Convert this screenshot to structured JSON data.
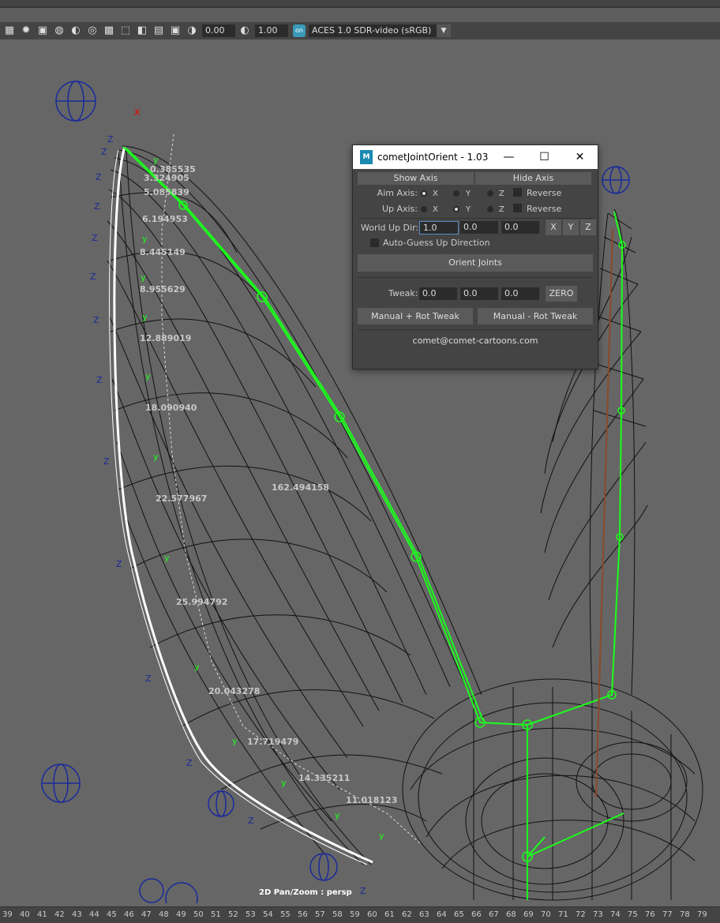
{
  "toolbar": {
    "exposure": "0.00",
    "gamma": "1.00",
    "color_mgmt_badge": "on",
    "view_transform": "ACES 1.0 SDR-video (sRGB)"
  },
  "viewport": {
    "label": "2D Pan/Zoom : persp",
    "measurements": [
      "0.385535",
      "3.324905",
      "5.085839",
      "6.194953",
      "8.445149",
      "8.955629",
      "12.889019",
      "18.090940",
      "22.577967",
      "162.494158",
      "25.994792",
      "20.043278",
      "17.719479",
      "14.335211",
      "11.018123"
    ]
  },
  "ruler": {
    "ticks": [
      "39",
      "40",
      "41",
      "42",
      "43",
      "44",
      "45",
      "46",
      "47",
      "48",
      "49",
      "50",
      "51",
      "52",
      "53",
      "54",
      "55",
      "56",
      "57",
      "58",
      "59",
      "60",
      "61",
      "62",
      "63",
      "64",
      "65",
      "66",
      "67",
      "68",
      "69",
      "70",
      "71",
      "72",
      "73",
      "74",
      "75",
      "76",
      "77",
      "78",
      "79"
    ]
  },
  "dialog": {
    "logo": "M",
    "title": "cometJointOrient - 1.03",
    "show_axis": "Show Axis",
    "hide_axis": "Hide Axis",
    "aim_axis_label": "Aim Axis:",
    "up_axis_label": "Up  Axis:",
    "axis_x": "X",
    "axis_y": "Y",
    "axis_z": "Z",
    "aim_selected": "X",
    "up_selected": "Y",
    "reverse_label": "Reverse",
    "world_up_label": "World Up Dir:",
    "world_up": [
      "1.0",
      "0.0",
      "0.0"
    ],
    "btn_x": "X",
    "btn_y": "Y",
    "btn_z": "Z",
    "auto_guess": "Auto-Guess Up Direction",
    "orient_joints": "Orient Joints",
    "tweak_label": "Tweak:",
    "tweak": [
      "0.0",
      "0.0",
      "0.0"
    ],
    "zero": "ZERO",
    "manual_plus": "Manual + Rot Tweak",
    "manual_minus": "Manual - Rot Tweak",
    "email": "comet@comet-cartoons.com"
  }
}
